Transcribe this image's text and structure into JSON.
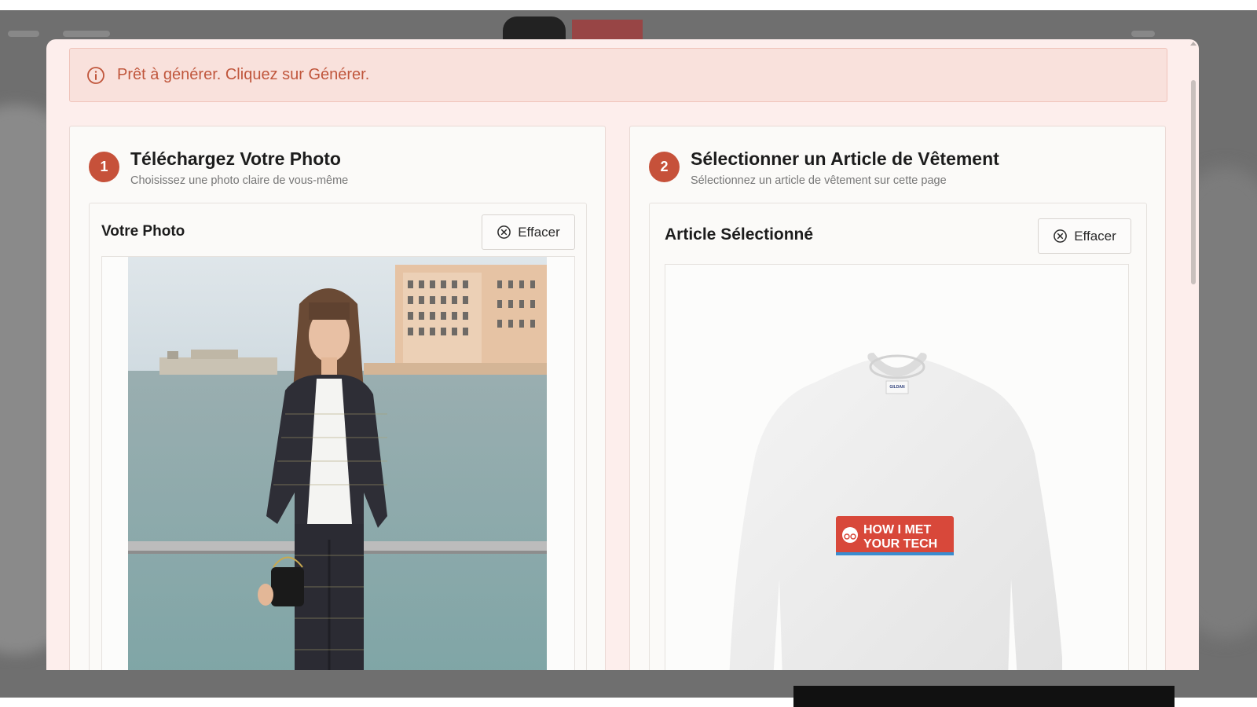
{
  "alert": {
    "icon": "info-icon",
    "message": "Prêt à générer. Cliquez sur Générer."
  },
  "colors": {
    "accent": "#c6513a",
    "alert_text": "#c0563c",
    "alert_bg": "#f9e1dc",
    "modal_bg": "#fdeeec"
  },
  "step1": {
    "number": "1",
    "title": "Téléchargez Votre Photo",
    "subtitle": "Choisissez une photo claire de vous-même",
    "panel_title": "Votre Photo",
    "clear_label": "Effacer",
    "clear_icon": "x-circle-icon"
  },
  "step2": {
    "number": "2",
    "title": "Sélectionner un Article de Vêtement",
    "subtitle": "Sélectionnez un article de vêtement sur cette page",
    "panel_title": "Article Sélectionné",
    "clear_label": "Effacer",
    "clear_icon": "x-circle-icon",
    "garment_print_line1": "HOW I MET",
    "garment_print_line2": "YOUR TECH",
    "garment_tag": "GILDAN"
  }
}
